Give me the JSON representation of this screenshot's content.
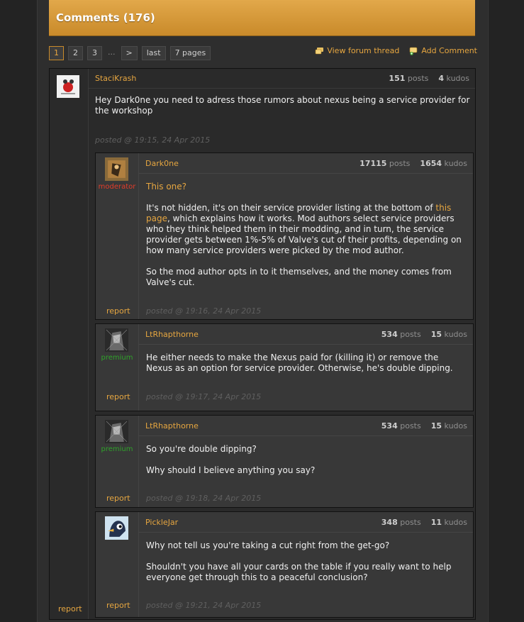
{
  "header": {
    "title": "Comments (176)"
  },
  "pager": {
    "pages": [
      "1",
      "2",
      "3"
    ],
    "ellipsis": "...",
    "next": ">",
    "last": "last",
    "total": "7 pages"
  },
  "links": {
    "view_thread": "View forum thread",
    "add_comment": "Add Comment"
  },
  "colors": {
    "accent": "#e6a640",
    "moderator": "#e23c2a",
    "premium": "#2fa22a"
  },
  "main_comment": {
    "user": "StaciKrash",
    "posts": "151",
    "posts_label": "posts",
    "kudos": "4",
    "kudos_label": "kudos",
    "text": "Hey Dark0ne you need to adress those rumors about nexus being a service provider for the workshop",
    "posted": "posted @ 19:15, 24 Apr 2015",
    "report": "report"
  },
  "replies": [
    {
      "user": "Dark0ne",
      "role": "moderator",
      "posts": "17115",
      "posts_label": "posts",
      "kudos": "1654",
      "kudos_label": "kudos",
      "quote": "This one?",
      "p1_before": "It's not hidden, it's on their service provider listing at the bottom of ",
      "p1_link": "this page",
      "p1_after": ", which explains how it works. Mod authors select service providers who they think helped them in their modding, and in turn, the service provider gets between 1%-5% of Valve's cut of their profits, depending on how many service providers were picked by the mod author.",
      "p2": "So the mod author opts in to it themselves, and the money comes from Valve's cut.",
      "posted": "posted @ 19:16, 24 Apr 2015",
      "report": "report"
    },
    {
      "user": "LtRhapthorne",
      "role": "premium",
      "posts": "534",
      "posts_label": "posts",
      "kudos": "15",
      "kudos_label": "kudos",
      "p1": "He either needs to make the Nexus paid for (killing it) or remove the Nexus as an option for service provider. Otherwise, he's double dipping.",
      "posted": "posted @ 19:17, 24 Apr 2015",
      "report": "report"
    },
    {
      "user": "LtRhapthorne",
      "role": "premium",
      "posts": "534",
      "posts_label": "posts",
      "kudos": "15",
      "kudos_label": "kudos",
      "p1": "So you're double dipping?",
      "p2": "Why should I believe anything you say?",
      "posted": "posted @ 19:18, 24 Apr 2015",
      "report": "report"
    },
    {
      "user": "PickleJar",
      "posts": "348",
      "posts_label": "posts",
      "kudos": "11",
      "kudos_label": "kudos",
      "p1": "Why not tell us you're taking a cut right from the get-go?",
      "p2": "Shouldn't you have all your cards on the table if you really want to help everyone get through this to a peaceful conclusion?",
      "posted": "posted @ 19:21, 24 Apr 2015",
      "report": "report"
    }
  ]
}
